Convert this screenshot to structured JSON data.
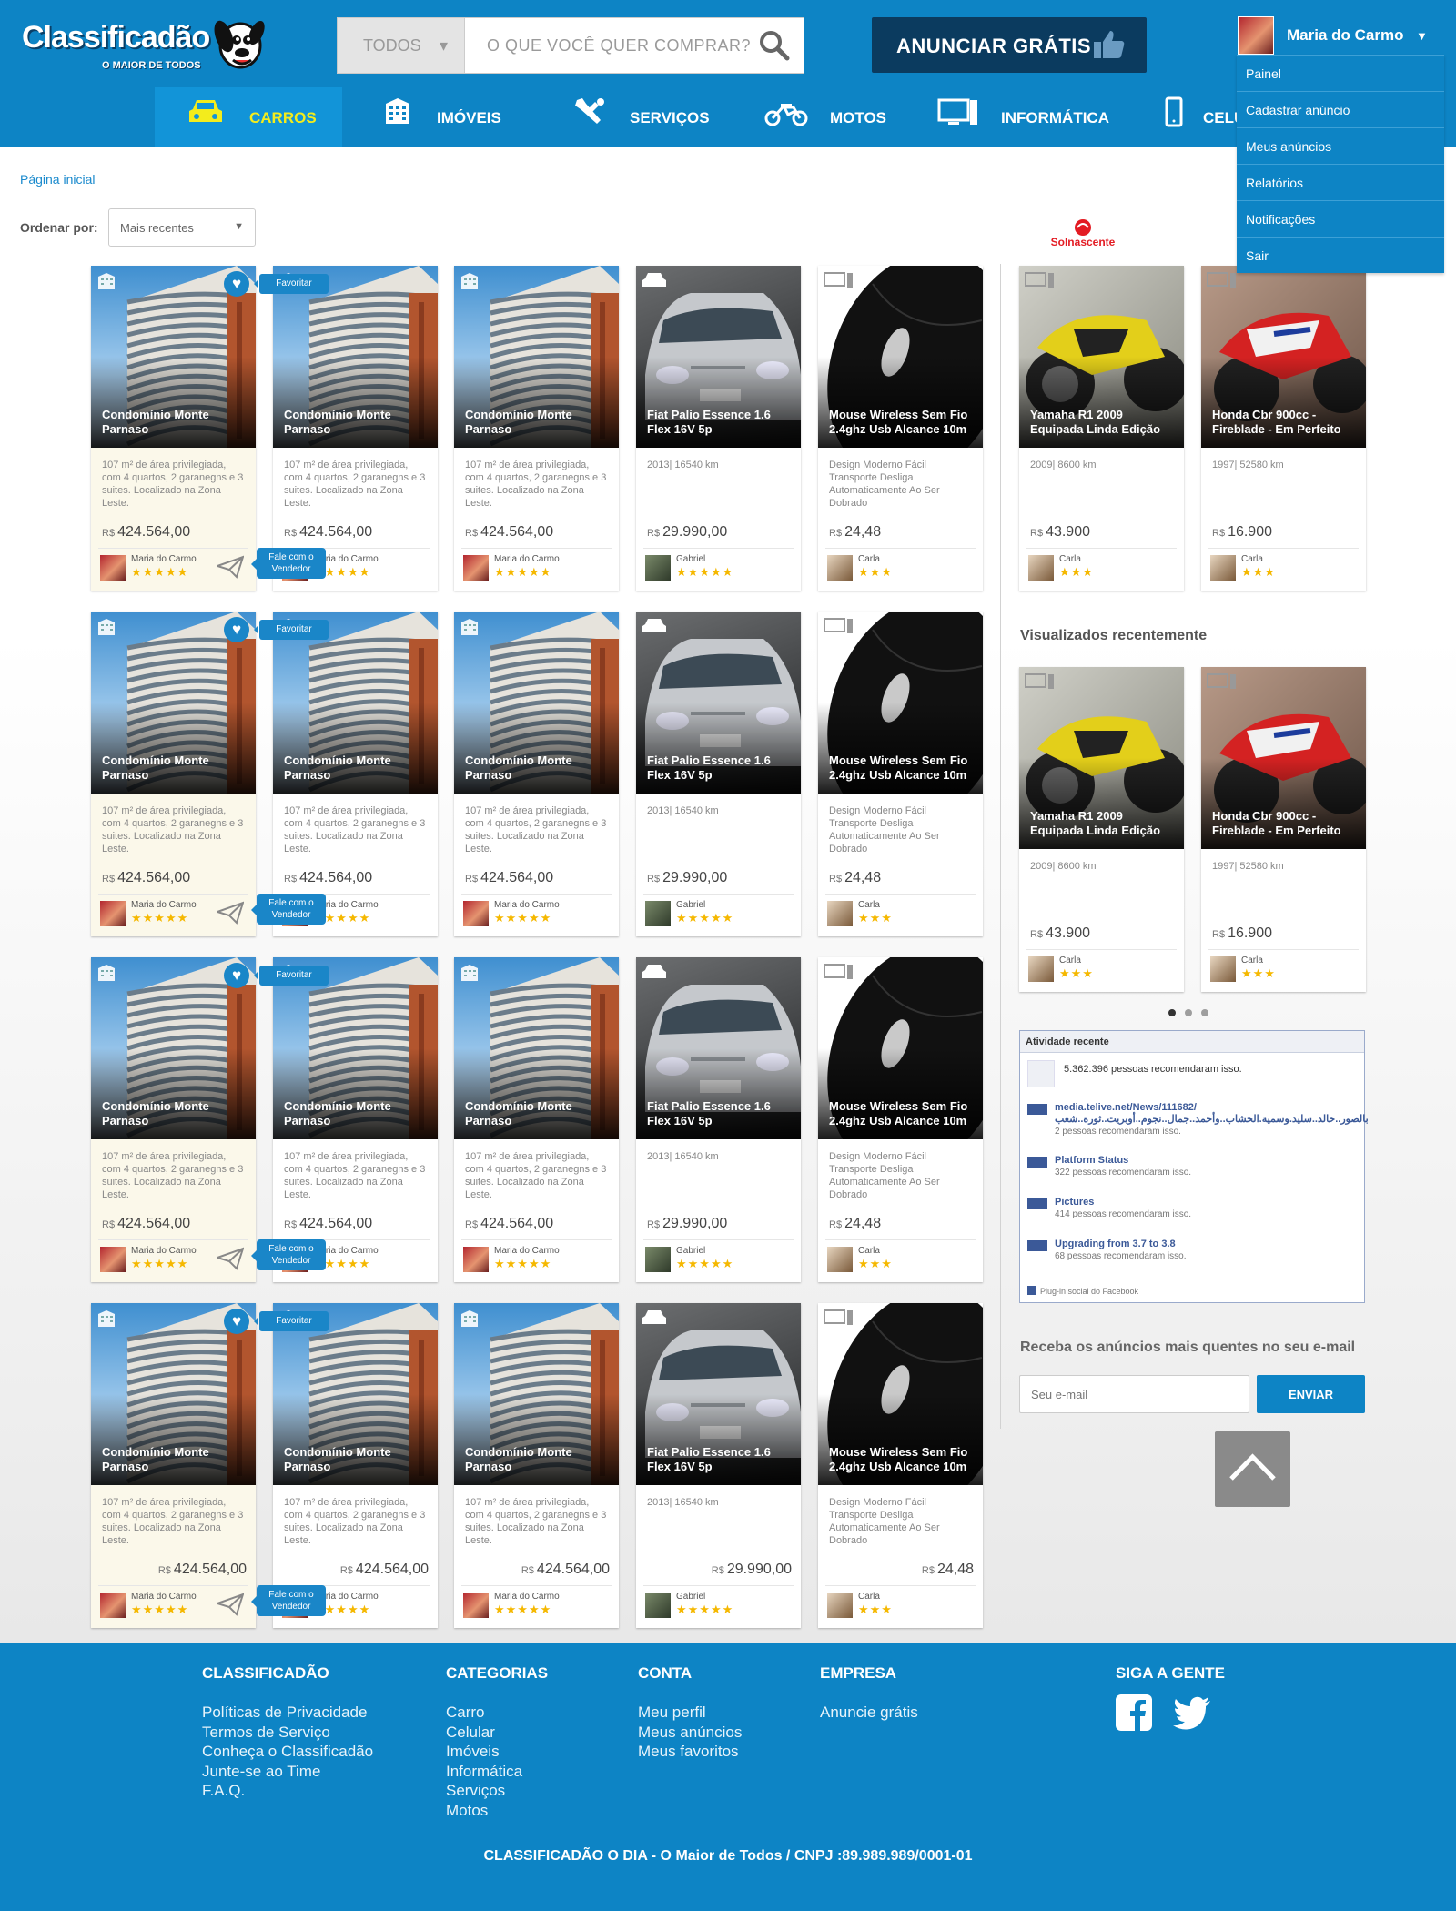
{
  "header": {
    "logo_main": "Classificadão",
    "logo_tagline": "O MAIOR DE TODOS",
    "search_category": "TODOS",
    "search_placeholder": "O QUE VOCÊ QUER COMPRAR?",
    "announce_label": "ANUNCIAR GRÁTIS",
    "user_name": "Maria do Carmo",
    "user_menu": [
      "Painel",
      "Cadastrar anúncio",
      "Meus anúncios",
      "Relatórios",
      "Notificações",
      "Sair"
    ],
    "categories": [
      "CARROS",
      "IMÓVEIS",
      "SERVIÇOS",
      "MOTOS",
      "INFORMÁTICA",
      "CELU"
    ]
  },
  "breadcrumb": "Página inicial",
  "sort": {
    "label": "Ordenar por:",
    "value": "Mais recentes"
  },
  "listing_cards": [
    {
      "type": "building",
      "title": "Condomínio Monte Parnaso",
      "desc": "107 m² de área privilegiada, com 4 quartos, 2 garanegns e 3 suites. Localizado na Zona Leste.",
      "currency": "R$",
      "price": "424.564,00",
      "seller": "Maria do Carmo",
      "stars": "★★★★★"
    },
    {
      "type": "building",
      "title": "Condomínio Monte Parnaso",
      "desc": "107 m² de área privilegiada, com 4 quartos, 2 garanegns e 3 suites. Localizado na Zona Leste.",
      "currency": "R$",
      "price": "424.564,00",
      "seller": "Maria do Carmo",
      "stars": "★★★★★"
    },
    {
      "type": "building",
      "title": "Condomínio Monte Parnaso",
      "desc": "107 m² de área privilegiada, com 4 quartos, 2 garanegns e 3 suites. Localizado na Zona Leste.",
      "currency": "R$",
      "price": "424.564,00",
      "seller": "Maria do Carmo",
      "stars": "★★★★★"
    },
    {
      "type": "car",
      "title": "Fiat Palio Essence 1.6 Flex 16V 5p",
      "desc": "2013| 16540 km",
      "currency": "R$",
      "price": "29.990,00",
      "seller": "Gabriel",
      "stars": "★★★★★"
    },
    {
      "type": "mouse",
      "title": "Mouse Wireless Sem Fio 2.4ghz Usb Alcance 10m",
      "desc": "Design Moderno Fácil Transporte Desliga Automaticamente Ao Ser Dobrado",
      "currency": "R$",
      "price": "24,48",
      "seller": "Carla",
      "stars": "★★★"
    }
  ],
  "card_labels": {
    "favorite": "Favoritar",
    "contact_line1": "Fale com o",
    "contact_line2": "Vendedor"
  },
  "sidebar_ad": "Solnascente",
  "side_cards": [
    {
      "type": "moto1",
      "title": "Yamaha R1 2009 Equipada Linda Edição",
      "desc": "2009| 8600 km",
      "currency": "R$",
      "price": "43.900",
      "seller": "Carla",
      "stars": "★★★"
    },
    {
      "type": "moto2",
      "title": "Honda Cbr 900cc - Fireblade - Em Perfeito",
      "desc": "1997| 52580 km",
      "currency": "R$",
      "price": "16.900",
      "seller": "Carla",
      "stars": "★★★"
    }
  ],
  "recent": {
    "title": "Visualizados recentemente"
  },
  "facebook": {
    "title": "Atividade recente",
    "top_count": "5.362.396 pessoas recomendaram isso.",
    "items": [
      {
        "title": "media.telive.net/News/111682/ بالصور..خالد..سليد.وسمية.الخشاب..وأحمد..جمال..نجوم..أوبريت..ثورة..شعب",
        "count": "2 pessoas recomendaram isso."
      },
      {
        "title": "Platform Status",
        "count": "322 pessoas recomendaram isso."
      },
      {
        "title": "Pictures",
        "count": "414 pessoas recomendaram isso."
      },
      {
        "title": "Upgrading from 3.7 to 3.8",
        "count": "68 pessoas recomendaram isso."
      }
    ],
    "footer": "Plug-in social do Facebook"
  },
  "newsletter": {
    "title": "Receba os anúncios mais quentes no seu e-mail",
    "placeholder": "Seu e-mail",
    "button": "ENVIAR"
  },
  "footer": {
    "col1": {
      "title": "CLASSIFICADÃO",
      "links": [
        "Políticas de Privacidade",
        "Termos de Serviço",
        "Conheça o Classificadão",
        "Junte-se ao Time",
        "F.A.Q."
      ]
    },
    "col2": {
      "title": "CATEGORIAS",
      "links": [
        "Carro",
        "Celular",
        "Imóveis",
        "Informática",
        "Serviços",
        "Motos"
      ]
    },
    "col3": {
      "title": "CONTA",
      "links": [
        "Meu perfil",
        "Meus anúncios",
        "Meus favoritos"
      ]
    },
    "col4": {
      "title": "EMPRESA",
      "links": [
        "Anuncie grátis"
      ]
    },
    "social_title": "SIGA A GENTE",
    "copyright": "CLASSIFICADÃO O DIA - O Maior de Todos / CNPJ :89.989.989/0001-01"
  },
  "colors": {
    "brand_blue": "#0d84c5",
    "dark_button": "#0b3b5f",
    "active_nav_text": "#f3ec1c",
    "star": "#f5b800"
  }
}
